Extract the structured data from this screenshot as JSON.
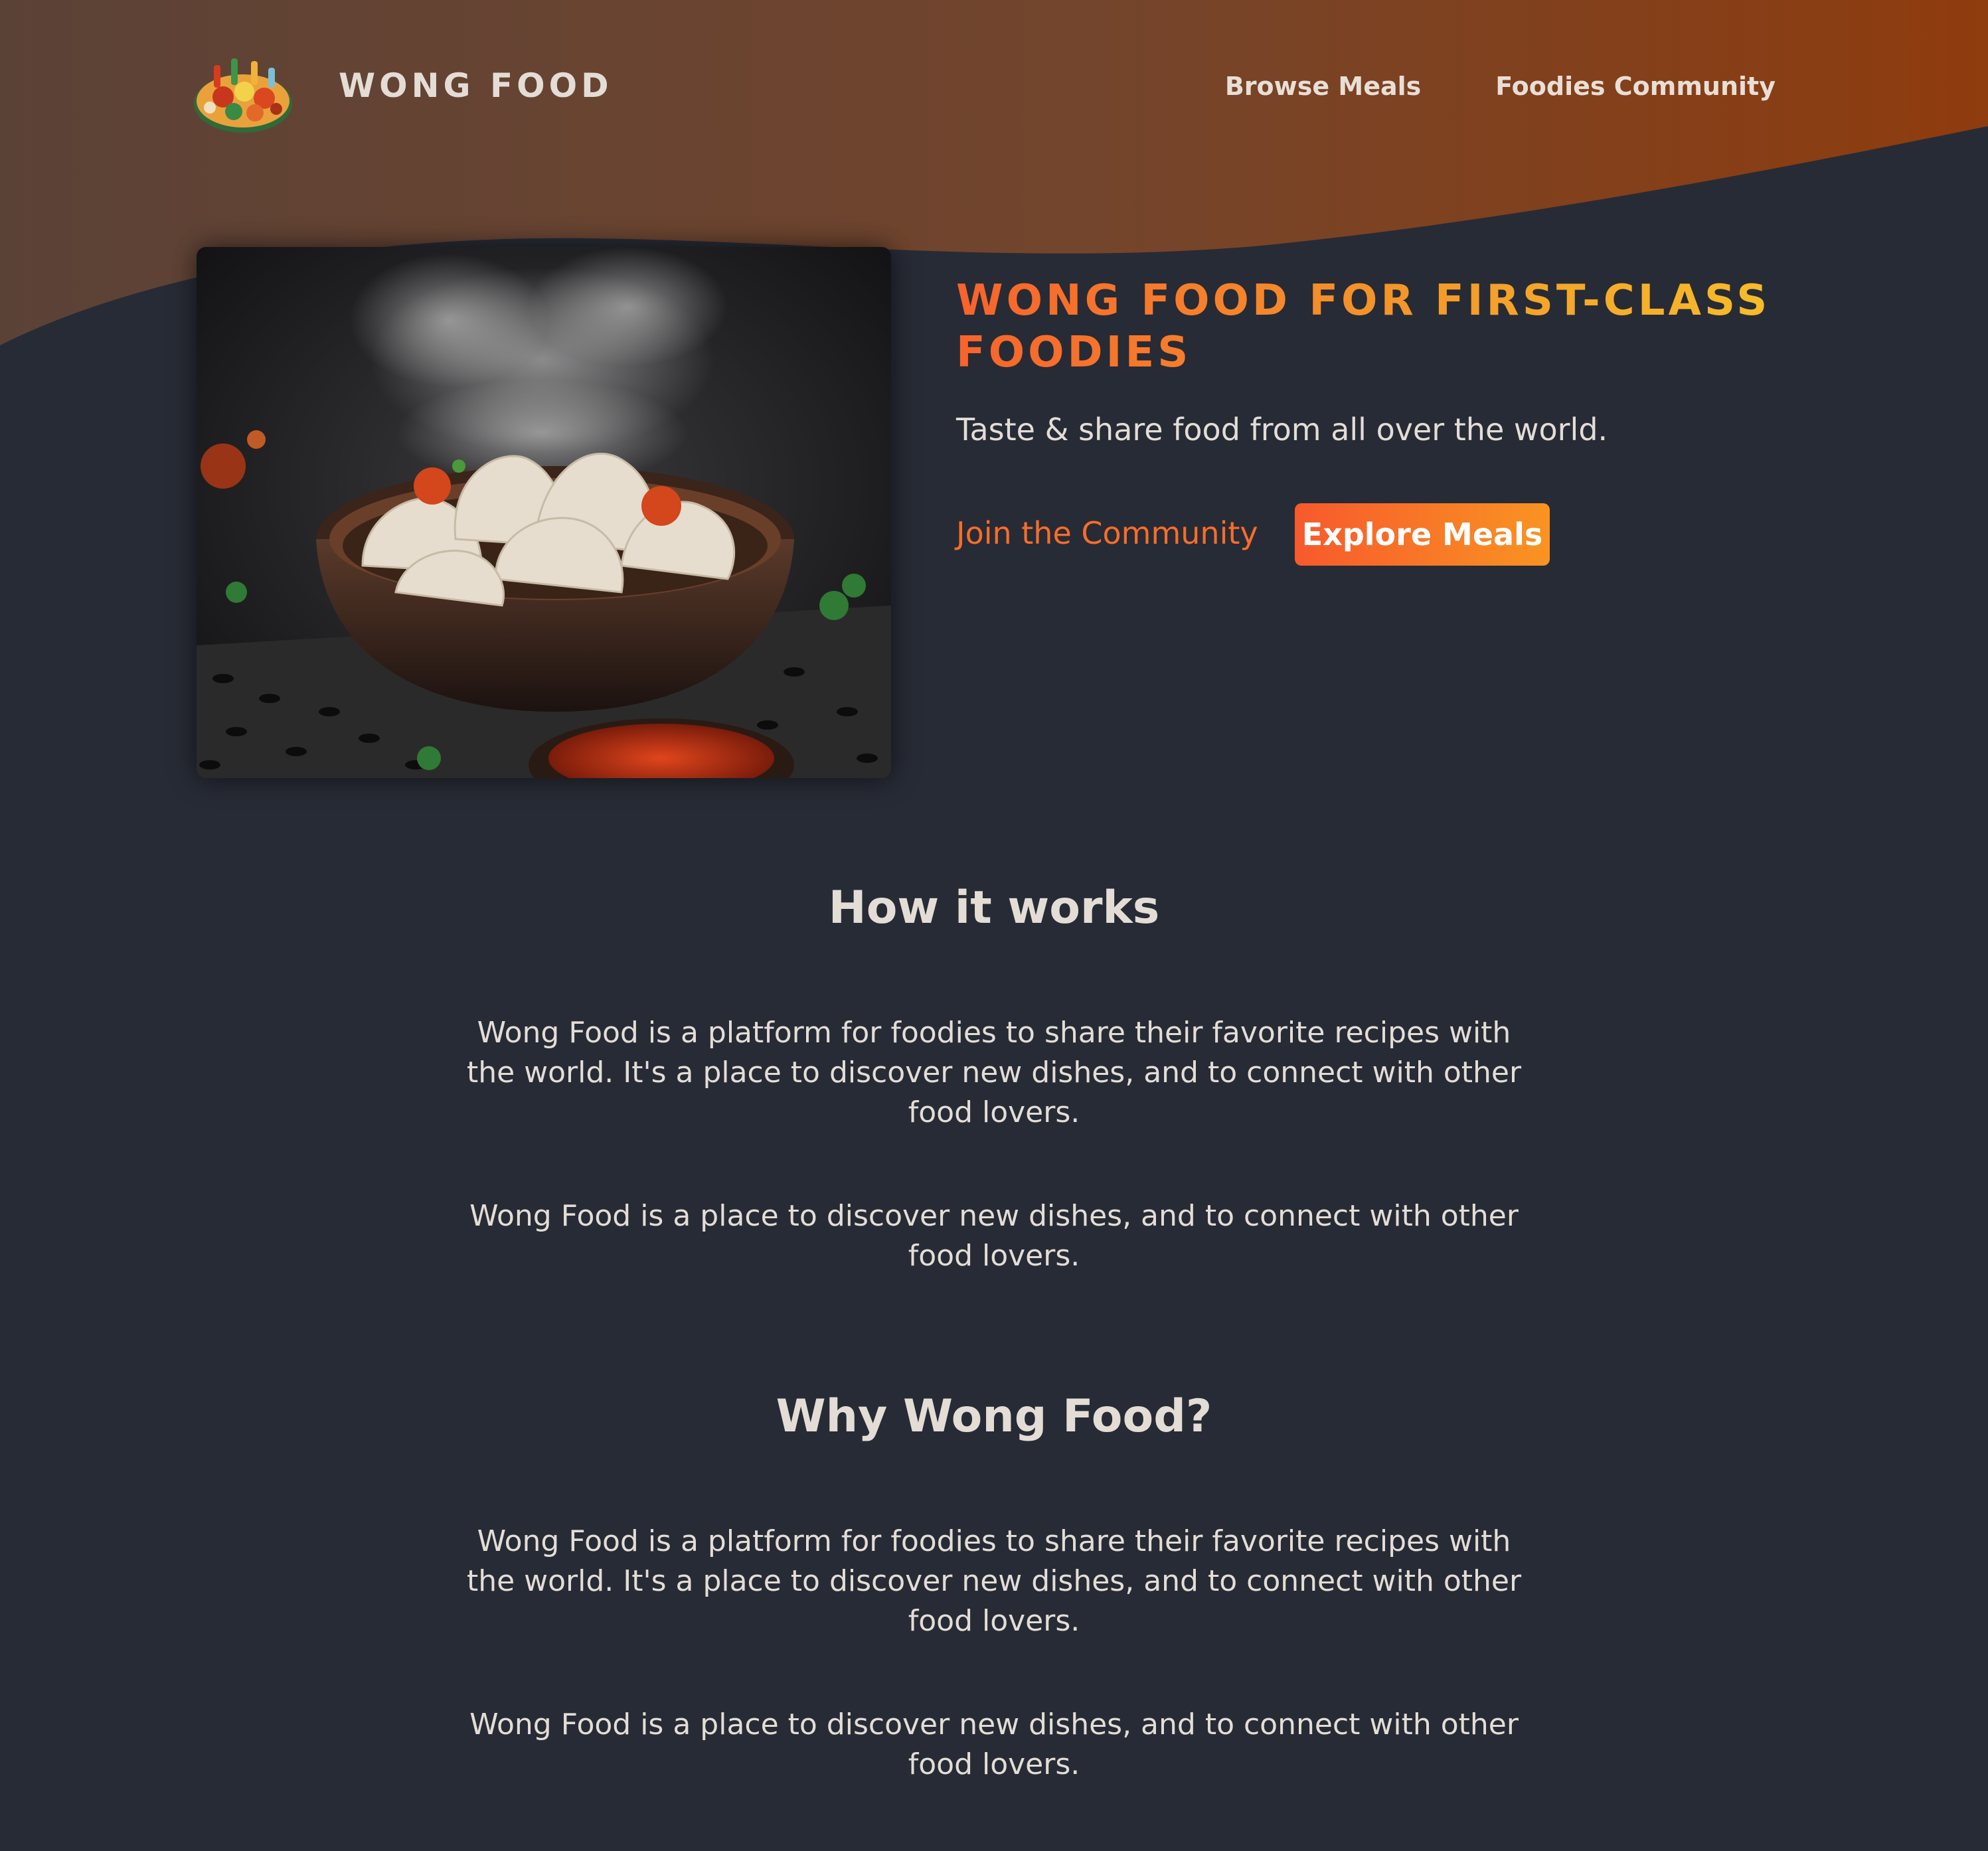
{
  "colors": {
    "page_background": "#272b35",
    "header_gradient_start": "#5b4237",
    "header_gradient_end": "#8f3c0e",
    "accent_orange": "#f76d2a",
    "accent_yellow": "#f7c12a",
    "text_light": "#e3ddd6"
  },
  "header": {
    "logo_icon": "food-platter-icon",
    "brand": "WONG FOOD",
    "nav": [
      {
        "label": "Browse Meals"
      },
      {
        "label": "Foodies Community"
      }
    ]
  },
  "hero": {
    "image": "steaming-dumplings-photo",
    "title": "WONG FOOD FOR FIRST-CLASS FOODIES",
    "subtitle": "Taste & share food from all over the world.",
    "link_label": "Join the Community",
    "button_label": "Explore Meals"
  },
  "sections": [
    {
      "title": "How it works",
      "paragraphs": [
        "Wong Food is a platform for foodies to share their favorite recipes with the world. It's a place to discover new dishes, and to connect with other food lovers.",
        "Wong Food is a place to discover new dishes, and to connect with other food lovers."
      ]
    },
    {
      "title": "Why Wong Food?",
      "paragraphs": [
        "Wong Food is a platform for foodies to share their favorite recipes with the world. It's a place to discover new dishes, and to connect with other food lovers.",
        "Wong Food is a place to discover new dishes, and to connect with other food lovers."
      ]
    }
  ]
}
